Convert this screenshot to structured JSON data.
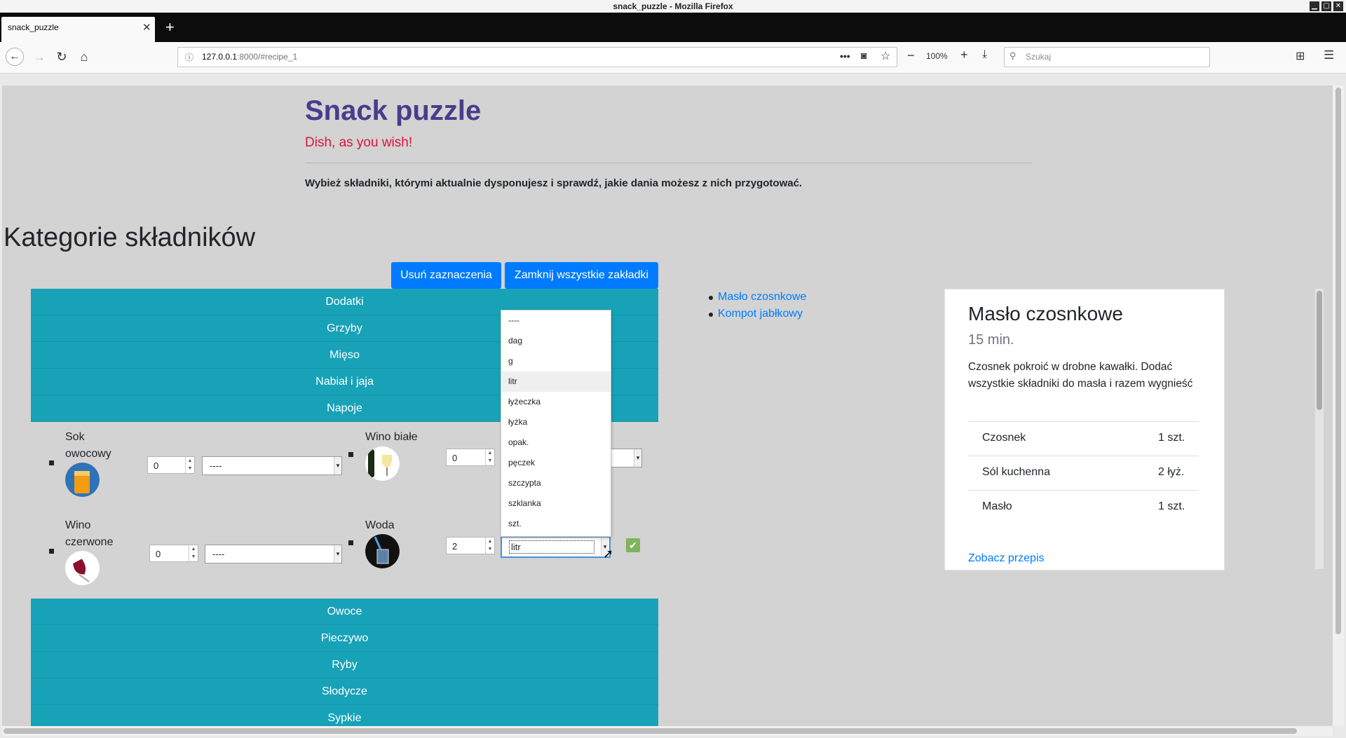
{
  "window": {
    "title": "snack_puzzle - Mozilla Firefox"
  },
  "tab": {
    "title": "snack_puzzle"
  },
  "url": {
    "host": "127.0.0.1",
    "rest": ":8000/#recipe_1"
  },
  "zoom": "100%",
  "search": {
    "placeholder": "Szukaj"
  },
  "header": {
    "title": "Snack puzzle",
    "subtitle": "Dish, as you wish!",
    "intro": "Wybież składniki, którymi aktualnie dysponujesz i sprawdź, jakie dania możesz z nich przygotować."
  },
  "categories_heading": "Kategorie składników",
  "buttons": {
    "clear": "Usuń zaznaczenia",
    "close_tabs": "Zamknij wszystkie zakładki"
  },
  "categories_top": [
    "Dodatki",
    "Grzyby",
    "Mięso",
    "Nabiał i jaja",
    "Napoje"
  ],
  "categories_bottom": [
    "Owoce",
    "Pieczywo",
    "Ryby",
    "Słodycze",
    "Sypkie"
  ],
  "ingredients": [
    {
      "name_l1": "Sok",
      "name_l2": "owocowy",
      "qty": "0",
      "unit": "----"
    },
    {
      "name_l1": "Wino białe",
      "name_l2": "",
      "qty": "0",
      "unit": ""
    },
    {
      "name_l1": "Wino",
      "name_l2": "czerwone",
      "qty": "0",
      "unit": "----"
    },
    {
      "name_l1": "Woda",
      "name_l2": "",
      "qty": "2",
      "unit": "litr"
    }
  ],
  "unit_options": [
    "----",
    "dag",
    "g",
    "litr",
    "łyżeczka",
    "łyżka",
    "opak.",
    "pęczek",
    "szczypta",
    "szklanka",
    "szt."
  ],
  "highlighted_option": "litr",
  "recipe_links": [
    "Masło czosnkowe",
    "Kompot jabłkowy"
  ],
  "recipe_card": {
    "title": "Masło czosnkowe",
    "time": "15 min.",
    "description": "Czosnek pokroić w drobne kawałki. Dodać wszystkie składniki do masła i razem wygnieść",
    "ingredients": [
      {
        "name": "Czosnek",
        "amount": "1 szt."
      },
      {
        "name": "Sól kuchenna",
        "amount": "2 łyż."
      },
      {
        "name": "Masło",
        "amount": "1 szt."
      }
    ],
    "link": "Zobacz przepis"
  },
  "colors": {
    "accent": "#17a2b8",
    "primary": "#007bff",
    "title": "#483d8b",
    "subtitle": "#dc143c",
    "confirm": "#7db45c"
  }
}
